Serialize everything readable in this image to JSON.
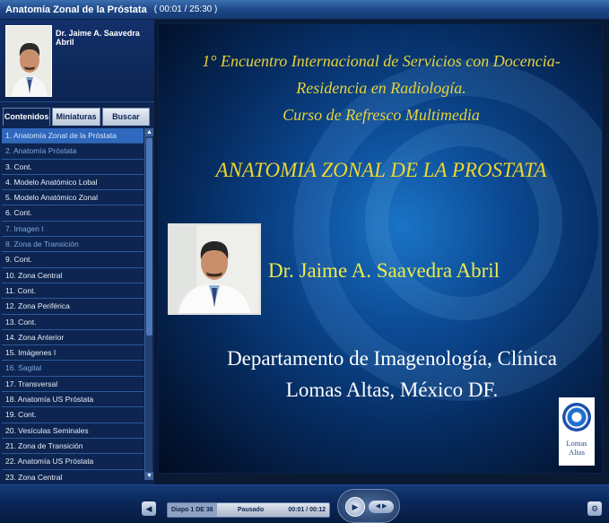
{
  "window": {
    "title": "Anatomía Zonal de la Próstata",
    "time": "( 00:01 / 25:30 )"
  },
  "presenter": {
    "name": "Dr. Jaime A. Saavedra Abril"
  },
  "tabs": [
    {
      "label": "Contenidos"
    },
    {
      "label": "Miniaturas"
    },
    {
      "label": "Buscar"
    }
  ],
  "outline": [
    "1. Anatomía Zonal de la Próstata",
    "2. Anatomía Próstata",
    "3. Cont.",
    "4. Modelo Anatómico Lobal",
    "5. Modelo Anatómico Zonal",
    "6. Cont.",
    "7. Imagen I",
    "8. Zona de Transición",
    "9. Cont.",
    "10. Zona Central",
    "11. Cont.",
    "12. Zona Periférica",
    "13. Cont.",
    "14. Zona Anterior",
    "15. Imágenes I",
    "16. Sagital",
    "17. Transversal",
    "18. Anatomía US Próstata",
    "19. Cont.",
    "20. Vesículas Seminales",
    "21. Zona de Transición",
    "22. Anatomía US Próstata",
    "23. Zona Central"
  ],
  "slide": {
    "heading": [
      "1° Encuentro Internacional de Servicios con Docencia-",
      "Residencia en Radiología.",
      "Curso  de Refresco Multimedia"
    ],
    "topic": "ANATOMIA ZONAL DE LA PROSTATA",
    "presenter": "Dr. Jaime A. Saavedra Abril",
    "department": [
      "Departamento de Imagenología, Clínica",
      "Lomas Altas, México DF."
    ],
    "logo": [
      "Lomas",
      "Altas"
    ]
  },
  "status": {
    "slide": "Diapo 1 DE 36",
    "state": "Pausado",
    "time": "00:01 / 00:12"
  },
  "colors": {
    "accent": "#2f69bd",
    "heading": "#e6d338",
    "background": "#0d2550"
  }
}
